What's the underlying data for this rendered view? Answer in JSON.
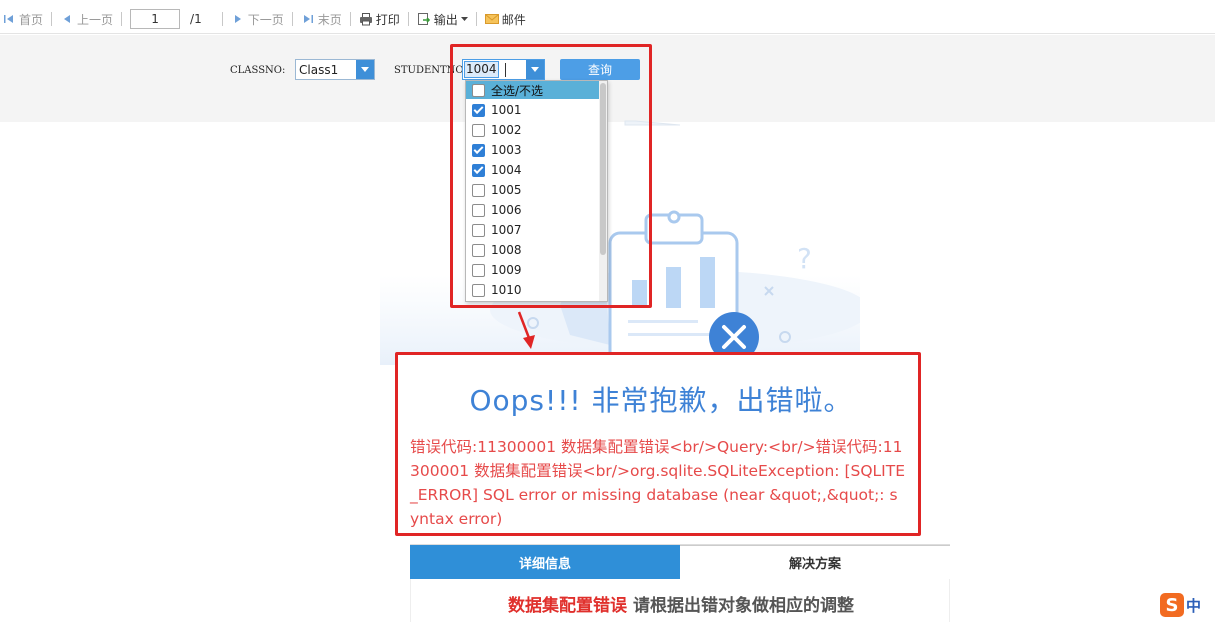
{
  "toolbar": {
    "first_label": "首页",
    "prev_label": "上一页",
    "page_value": "1",
    "page_total": "/1",
    "next_label": "下一页",
    "last_label": "末页",
    "print_label": "打印",
    "export_label": "输出",
    "mail_label": "邮件"
  },
  "params": {
    "classno_label": "CLASSNO:",
    "classno_value": "Class1",
    "studentno_label": "STUDENTNO:",
    "studentno_value": "1004",
    "query_label": "查询"
  },
  "dropdown": {
    "select_all_label": "全选/不选",
    "select_all_checked": false,
    "items": [
      {
        "label": "1001",
        "checked": true
      },
      {
        "label": "1002",
        "checked": false
      },
      {
        "label": "1003",
        "checked": true
      },
      {
        "label": "1004",
        "checked": true
      },
      {
        "label": "1005",
        "checked": false
      },
      {
        "label": "1006",
        "checked": false
      },
      {
        "label": "1007",
        "checked": false
      },
      {
        "label": "1008",
        "checked": false
      },
      {
        "label": "1009",
        "checked": false
      },
      {
        "label": "1010",
        "checked": false
      }
    ]
  },
  "error": {
    "title": "Oops!!! 非常抱歉，出错啦。",
    "message": "错误代码:11300001 数据集配置错误<br/>Query:<br/>错误代码:11300001 数据集配置错误<br/>org.sqlite.SQLiteException: [SQLITE_ERROR] SQL error or missing database (near &quot;,&quot;: syntax error)"
  },
  "tabs": {
    "detail_label": "详细信息",
    "solution_label": "解决方案"
  },
  "panel": {
    "error_name": "数据集配置错误",
    "hint": "请根据出错对象做相应的调整"
  },
  "ime": {
    "logo": "S",
    "mode": "中"
  },
  "colors": {
    "accent": "#2f8fd8",
    "error_red": "#e64a4a",
    "annotation_red": "#e02525",
    "title_blue": "#3e82d6"
  }
}
